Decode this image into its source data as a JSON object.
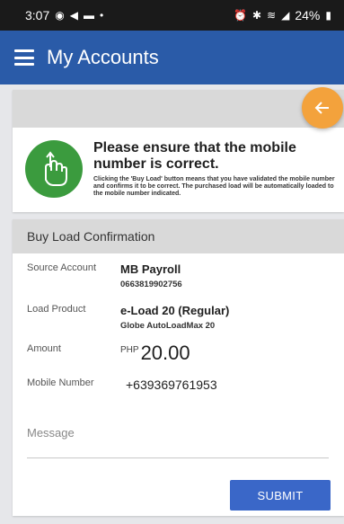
{
  "status_bar": {
    "time": "3:07",
    "battery": "24%"
  },
  "app_bar": {
    "title": "My Accounts"
  },
  "notice": {
    "title": "Please ensure that the mobile number is correct.",
    "description": "Clicking the 'Buy Load' button means that you have validated the mobile number and confirms it to be correct. The purchased load will be automatically loaded to the mobile number indicated."
  },
  "confirmation": {
    "header": "Buy Load Confirmation",
    "source_account": {
      "label": "Source Account",
      "name": "MB Payroll",
      "number": "0663819902756"
    },
    "load_product": {
      "label": "Load Product",
      "name": "e-Load 20 (Regular)",
      "detail": "Globe AutoLoadMax 20"
    },
    "amount": {
      "label": "Amount",
      "currency": "PHP",
      "value": "20.00"
    },
    "mobile_number": {
      "label": "Mobile Number",
      "value": "+639369761953"
    },
    "message_placeholder": "Message",
    "submit_label": "SUBMIT"
  },
  "colors": {
    "app_bar": "#2a5ba8",
    "fab": "#f3a23c",
    "submit": "#3a67c8",
    "hand_icon_bg": "#3b9b3e"
  },
  "icons": {
    "menu": "hamburger-icon",
    "back": "arrow-left-icon",
    "notice": "hand-tap-icon"
  }
}
